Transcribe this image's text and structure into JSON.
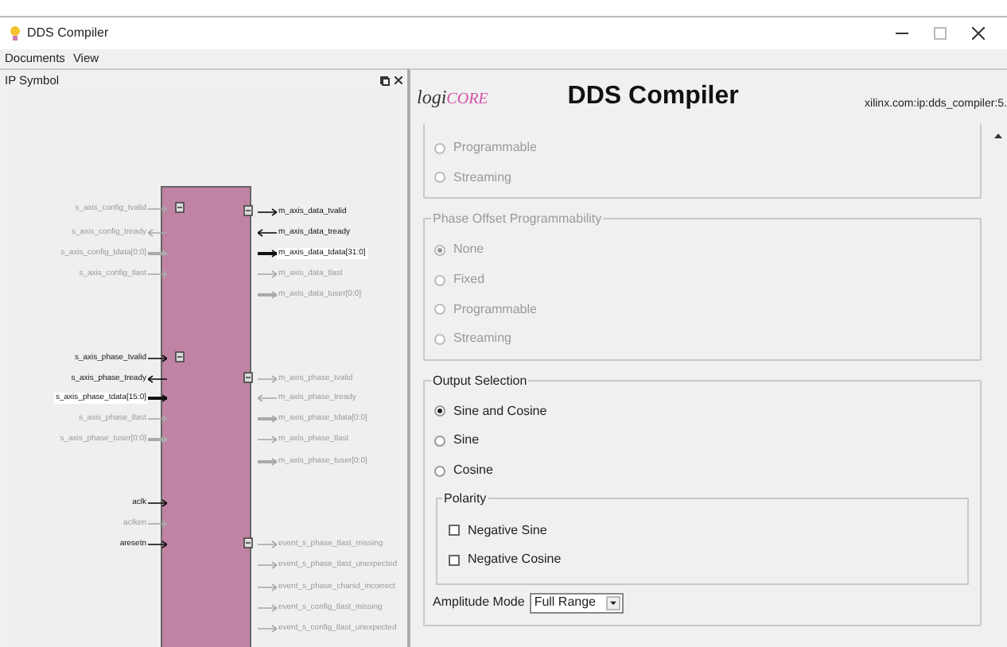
{
  "window": {
    "title": "DDS Compiler"
  },
  "menu": [
    "Documents",
    "View"
  ],
  "left_panel": {
    "title": "IP Symbol",
    "left_groups": [
      {
        "kind": "stream",
        "ports": [
          {
            "name": "s_axis_config_tvalid",
            "active": false,
            "bus": false,
            "output": false,
            "highlighted": false
          },
          {
            "name": "s_axis_config_tready",
            "active": false,
            "bus": false,
            "output": true,
            "highlighted": false
          },
          {
            "name": "s_axis_config_tdata[0:0]",
            "active": false,
            "bus": true,
            "output": false,
            "highlighted": false
          },
          {
            "name": "s_axis_config_tlast",
            "active": false,
            "bus": false,
            "output": false,
            "highlighted": false
          }
        ]
      },
      {
        "kind": "stream",
        "ports": [
          {
            "name": "s_axis_phase_tvalid",
            "active": true,
            "bus": false,
            "output": false,
            "highlighted": false
          },
          {
            "name": "s_axis_phase_tready",
            "active": true,
            "bus": false,
            "output": true,
            "highlighted": false
          },
          {
            "name": "s_axis_phase_tdata[15:0]",
            "active": true,
            "bus": true,
            "output": false,
            "highlighted": true
          },
          {
            "name": "s_axis_phase_tlast",
            "active": false,
            "bus": false,
            "output": false,
            "highlighted": false
          },
          {
            "name": "s_axis_phase_tuser[0:0]",
            "active": false,
            "bus": true,
            "output": false,
            "highlighted": false
          }
        ]
      },
      {
        "kind": "control",
        "ports": [
          {
            "name": "aclk",
            "active": true,
            "bus": false,
            "output": false,
            "highlighted": false
          },
          {
            "name": "aclken",
            "active": false,
            "bus": false,
            "output": false,
            "highlighted": false
          },
          {
            "name": "aresetn",
            "active": true,
            "bus": false,
            "output": false,
            "highlighted": false
          }
        ]
      }
    ],
    "right_groups": [
      {
        "kind": "stream",
        "ports": [
          {
            "name": "m_axis_data_tvalid",
            "active": true,
            "bus": false,
            "output": true,
            "highlighted": false
          },
          {
            "name": "m_axis_data_tready",
            "active": true,
            "bus": false,
            "output": false,
            "highlighted": false
          },
          {
            "name": "m_axis_data_tdata[31:0]",
            "active": true,
            "bus": true,
            "output": true,
            "highlighted": true
          },
          {
            "name": "m_axis_data_tlast",
            "active": false,
            "bus": false,
            "output": true,
            "highlighted": false
          },
          {
            "name": "m_axis_data_tuser[0:0]",
            "active": false,
            "bus": true,
            "output": true,
            "highlighted": false
          }
        ]
      },
      {
        "kind": "stream",
        "ports": [
          {
            "name": "m_axis_phase_tvalid",
            "active": false,
            "bus": false,
            "output": true,
            "highlighted": false
          },
          {
            "name": "m_axis_phase_tready",
            "active": false,
            "bus": false,
            "output": false,
            "highlighted": false
          },
          {
            "name": "m_axis_phase_tdata[0:0]",
            "active": false,
            "bus": true,
            "output": true,
            "highlighted": false
          },
          {
            "name": "m_axis_phase_tlast",
            "active": false,
            "bus": false,
            "output": true,
            "highlighted": false
          },
          {
            "name": "m_axis_phase_tuser[0:0]",
            "active": false,
            "bus": true,
            "output": true,
            "highlighted": false
          }
        ]
      },
      {
        "kind": "stream",
        "ports": [
          {
            "name": "event_s_phase_tlast_missing",
            "active": false,
            "bus": false,
            "output": true,
            "highlighted": false
          },
          {
            "name": "event_s_phase_tlast_unexpected",
            "active": false,
            "bus": false,
            "output": true,
            "highlighted": false
          },
          {
            "name": "event_s_phase_chanid_incorrect",
            "active": false,
            "bus": false,
            "output": true,
            "highlighted": false
          },
          {
            "name": "event_s_config_tlast_missing",
            "active": false,
            "bus": false,
            "output": true,
            "highlighted": false
          },
          {
            "name": "event_s_config_tlast_unexpected",
            "active": false,
            "bus": false,
            "output": true,
            "highlighted": false
          }
        ]
      }
    ]
  },
  "header": {
    "logo_prefix": "logi",
    "logo_suffix": "CORE",
    "title": "DDS Compiler",
    "vlnv": "xilinx.com:ip:dds_compiler:5."
  },
  "groups": [
    {
      "options": [
        {
          "label": "Programmable",
          "selected": false,
          "disabled": true
        },
        {
          "label": "Streaming",
          "selected": false,
          "disabled": true
        }
      ]
    },
    {
      "title": "Phase Offset Programmability",
      "disabled": true,
      "options": [
        {
          "label": "None",
          "selected": true,
          "disabled": true
        },
        {
          "label": "Fixed",
          "selected": false,
          "disabled": true
        },
        {
          "label": "Programmable",
          "selected": false,
          "disabled": true
        },
        {
          "label": "Streaming",
          "selected": false,
          "disabled": true
        }
      ]
    },
    {
      "title": "Output Selection",
      "disabled": false,
      "options": [
        {
          "label": "Sine and Cosine",
          "selected": true,
          "disabled": false
        },
        {
          "label": "Sine",
          "selected": false,
          "disabled": false
        },
        {
          "label": "Cosine",
          "selected": false,
          "disabled": false
        }
      ],
      "polarity": {
        "title": "Polarity",
        "checkboxes": [
          {
            "label": "Negative Sine",
            "checked": false
          },
          {
            "label": "Negative Cosine",
            "checked": false
          }
        ]
      },
      "amplitude": {
        "label": "Amplitude Mode",
        "value": "Full Range"
      }
    }
  ]
}
